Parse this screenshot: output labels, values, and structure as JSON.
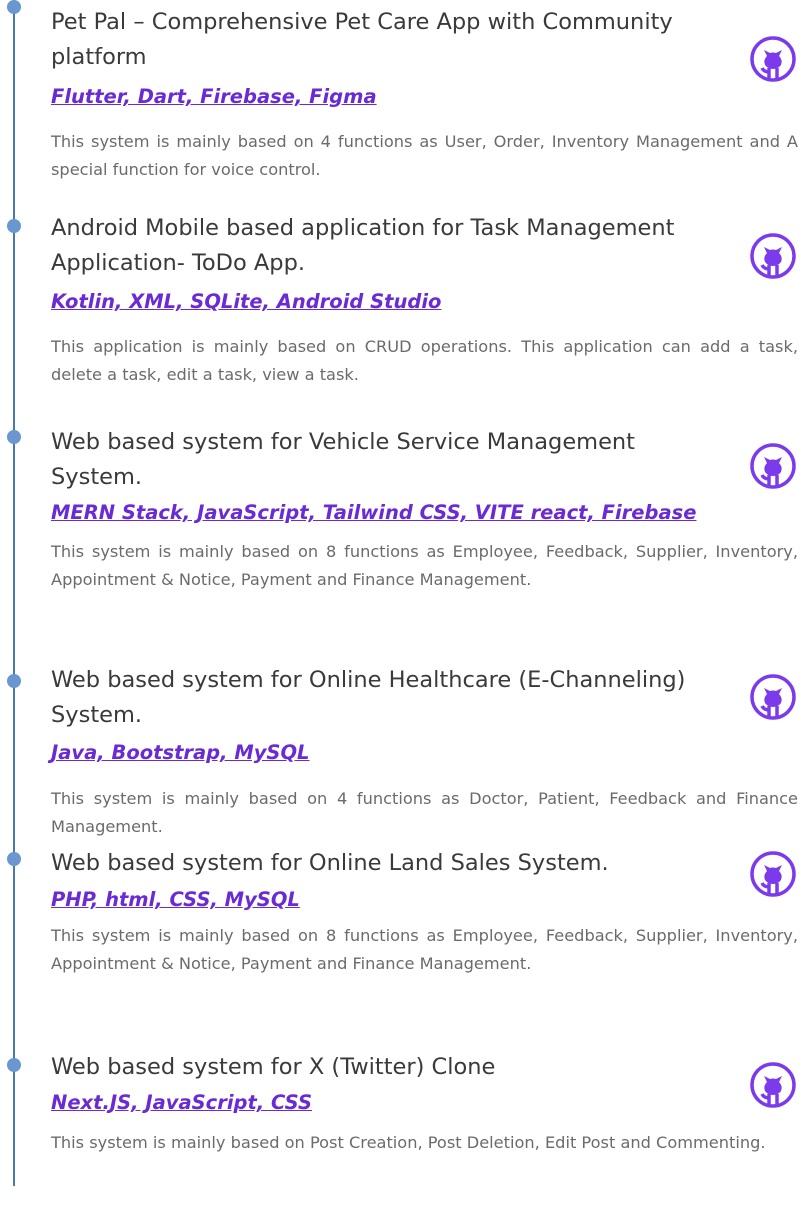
{
  "accent_color": "#7c3aed",
  "line_color": "#4a78b0",
  "icon": "github-icon",
  "projects": [
    {
      "title": "Pet Pal – Comprehensive Pet Care App with Community platform",
      "tech": "Flutter, Dart, Firebase, Figma",
      "description": "This system is mainly based on 4 functions as User, Order, Inventory Management and A special function for voice control."
    },
    {
      "title": "Android Mobile based application for Task Management Application- ToDo App.",
      "tech": "Kotlin, XML, SQLite, Android Studio",
      "description": "This application is mainly based on CRUD operations. This application can add a task, delete a task, edit a task, view a task."
    },
    {
      "title": "Web based system for Vehicle Service Management System.",
      "tech": "MERN Stack, JavaScript, Tailwind CSS, VITE react, Firebase",
      "description": "This system is mainly based on 8 functions as Employee, Feedback, Supplier, Inventory, Appointment & Notice, Payment and Finance Management."
    },
    {
      "title": "Web based system for Online Healthcare (E-Channeling) System.",
      "tech": "Java, Bootstrap, MySQL",
      "description": "This system is mainly based on 4 functions as Doctor, Patient, Feedback and Finance Management."
    },
    {
      "title": "Web based system for Online Land Sales System.",
      "tech": "PHP, html, CSS, MySQL",
      "description": "This system is mainly based on 8 functions as Employee, Feedback, Supplier, Inventory, Appointment & Notice, Payment and Finance Management."
    },
    {
      "title": "Web based system for X (Twitter) Clone",
      "tech": "Next.JS, JavaScript, CSS",
      "description": "This system is mainly based on Post Creation, Post Deletion, Edit Post and Commenting."
    }
  ]
}
